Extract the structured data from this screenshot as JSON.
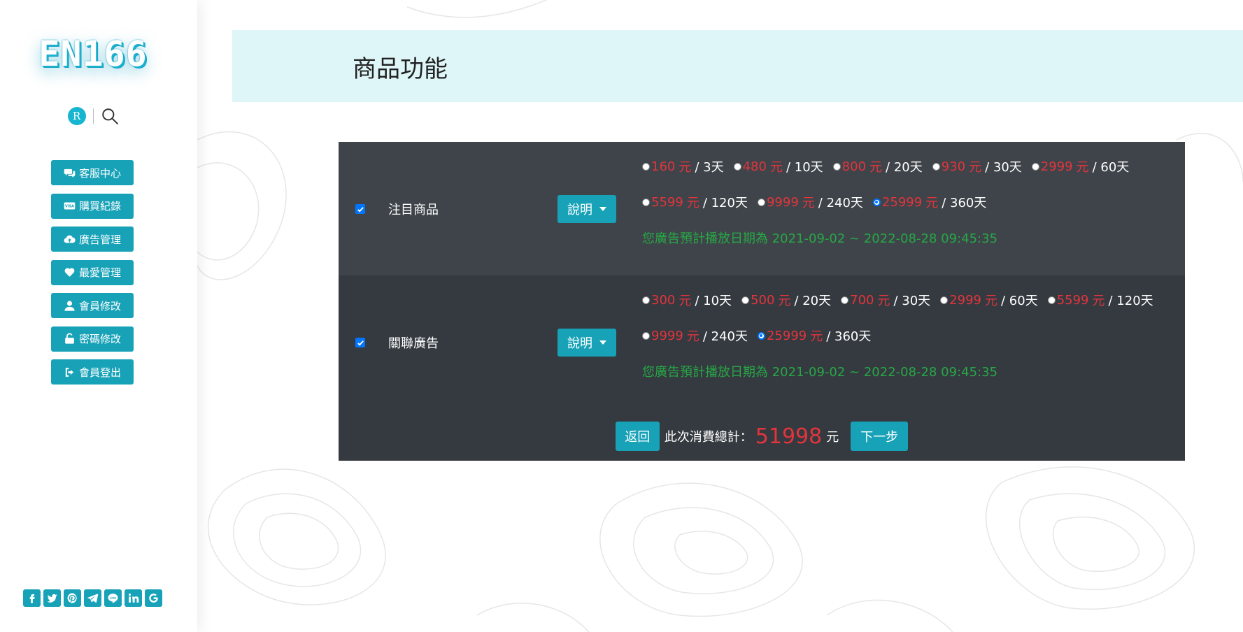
{
  "brand": {
    "logo_text": "EN166",
    "avatar_letter": "R"
  },
  "sidebar": {
    "items": [
      {
        "label": "客服中心",
        "icon": "chat-icon"
      },
      {
        "label": "購買紀錄",
        "icon": "visa-card-icon"
      },
      {
        "label": "廣告管理",
        "icon": "cloud-upload-icon"
      },
      {
        "label": "最愛管理",
        "icon": "heart-icon"
      },
      {
        "label": "會員修改",
        "icon": "user-icon"
      },
      {
        "label": "密碼修改",
        "icon": "unlock-icon"
      },
      {
        "label": "會員登出",
        "icon": "sign-out-icon"
      }
    ],
    "social": [
      "facebook-icon",
      "twitter-icon",
      "pinterest-icon",
      "telegram-icon",
      "line-icon",
      "linkedin-icon",
      "google-icon"
    ]
  },
  "header": {
    "title": "商品功能"
  },
  "products": [
    {
      "label": "注目商品",
      "checked": true,
      "info_label": "說明",
      "options_line1": [
        {
          "price": "160",
          "unit": "元",
          "period": "/ 3天"
        },
        {
          "price": "480",
          "unit": "元",
          "period": "/ 10天"
        },
        {
          "price": "800",
          "unit": "元",
          "period": "/ 20天"
        },
        {
          "price": "930",
          "unit": "元",
          "period": "/ 30天"
        },
        {
          "price": "2999",
          "unit": "元",
          "period": "/ 60天"
        }
      ],
      "options_line2": [
        {
          "price": "5599",
          "unit": "元",
          "period": "/ 120天"
        },
        {
          "price": "9999",
          "unit": "元",
          "period": "/ 240天"
        },
        {
          "price": "25999",
          "unit": "元",
          "period": "/ 360天"
        }
      ],
      "selected": "25999",
      "date_text": "您廣告預計播放日期為 2021-09-02 ~ 2022-08-28 09:45:35"
    },
    {
      "label": "關聯廣告",
      "checked": true,
      "info_label": "說明",
      "options_line1": [
        {
          "price": "300",
          "unit": "元",
          "period": "/ 10天"
        },
        {
          "price": "500",
          "unit": "元",
          "period": "/ 20天"
        },
        {
          "price": "700",
          "unit": "元",
          "period": "/ 30天"
        },
        {
          "price": "2999",
          "unit": "元",
          "period": "/ 60天"
        },
        {
          "price": "5599",
          "unit": "元",
          "period": "/ 120天"
        }
      ],
      "options_line2": [
        {
          "price": "9999",
          "unit": "元",
          "period": "/ 240天"
        },
        {
          "price": "25999",
          "unit": "元",
          "period": "/ 360天"
        }
      ],
      "selected": "25999",
      "date_text": "您廣告預計播放日期為 2021-09-02 ~ 2022-08-28 09:45:35"
    }
  ],
  "footer": {
    "back_label": "返回",
    "total_label": "此次消費總計：",
    "total_value": "51998",
    "total_unit": "元",
    "next_label": "下一步"
  },
  "colors": {
    "accent": "#17a2b8",
    "price": "#e3343c",
    "date": "#28a745",
    "panel": "#343a40",
    "header": "#dff6f9"
  }
}
